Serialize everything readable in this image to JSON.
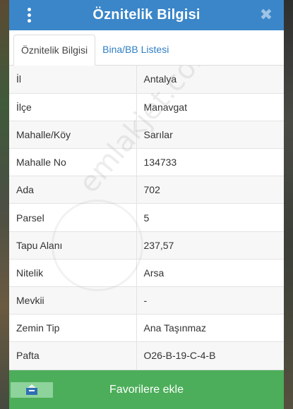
{
  "header": {
    "title": "Öznitelik Bilgisi",
    "close_symbol": "✖",
    "menu_icon": "more-vertical-icon"
  },
  "tabs": [
    {
      "label": "Öznitelik Bilgisi",
      "active": true
    },
    {
      "label": "Bina/BB Listesi",
      "active": false
    }
  ],
  "attributes": [
    {
      "key": "İl",
      "value": "Antalya"
    },
    {
      "key": "İlçe",
      "value": "Manavgat"
    },
    {
      "key": "Mahalle/Köy",
      "value": "Sarılar"
    },
    {
      "key": "Mahalle No",
      "value": "134733"
    },
    {
      "key": "Ada",
      "value": "702"
    },
    {
      "key": "Parsel",
      "value": "5"
    },
    {
      "key": "Tapu Alanı",
      "value": "237,57"
    },
    {
      "key": "Nitelik",
      "value": "Arsa"
    },
    {
      "key": "Mevkii",
      "value": "-"
    },
    {
      "key": "Zemin Tip",
      "value": "Ana Taşınmaz"
    },
    {
      "key": "Pafta",
      "value": "O26-B-19-C-4-B"
    }
  ],
  "footer": {
    "favorite_label": "Favorilere ekle",
    "favorite_icon": "favorite-icon"
  },
  "watermark": "emlakjet.com",
  "colors": {
    "header_bg": "#3a86c9",
    "tab_link": "#2f7fc4",
    "footer_bg": "#4cae5a"
  }
}
